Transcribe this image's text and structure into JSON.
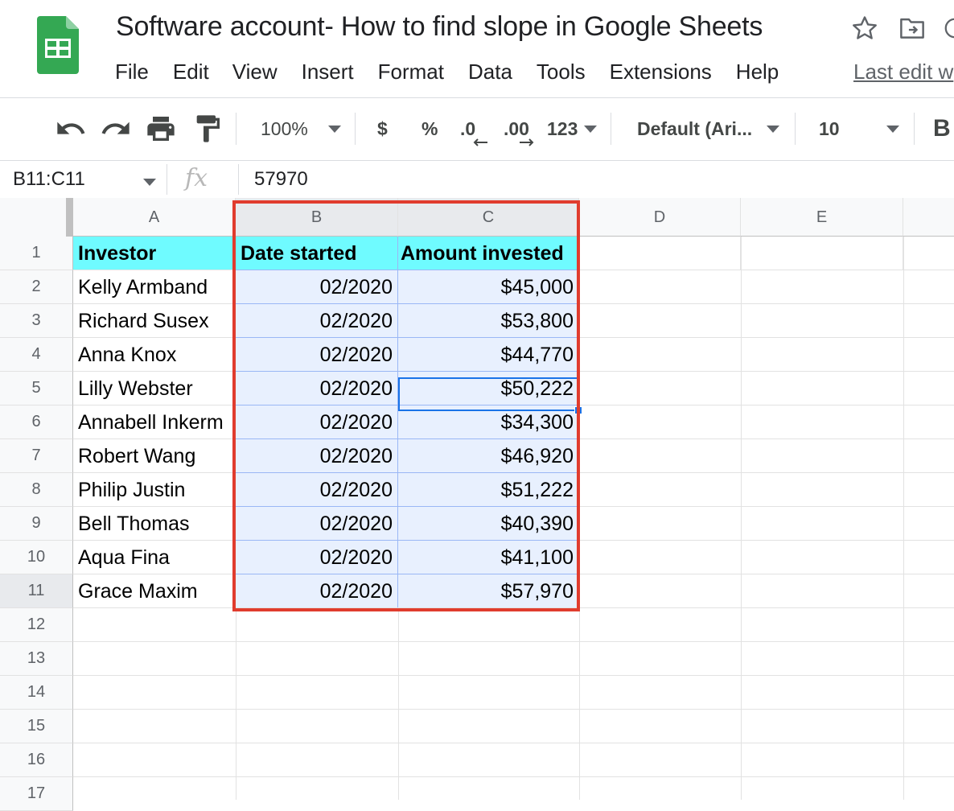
{
  "header": {
    "title": "Software account- How to find slope in Google Sheets",
    "menu": [
      "File",
      "Edit",
      "View",
      "Insert",
      "Format",
      "Data",
      "Tools",
      "Extensions",
      "Help"
    ],
    "last_edit": "Last edit w"
  },
  "toolbar": {
    "zoom": "100%",
    "currency": "$",
    "percent": "%",
    "decrease_decimal": ".0",
    "increase_decimal": ".00",
    "more_formats": "123",
    "font": "Default (Ari...",
    "font_size": "10",
    "bold": "B"
  },
  "formula_bar": {
    "name_box": "B11:C11",
    "fx": "fx",
    "value": "57970"
  },
  "sheet": {
    "columns": [
      "A",
      "B",
      "C",
      "D",
      "E"
    ],
    "rows": [
      "1",
      "2",
      "3",
      "4",
      "5",
      "6",
      "7",
      "8",
      "9",
      "10",
      "11",
      "12",
      "13",
      "14",
      "15",
      "16",
      "17"
    ],
    "header": [
      "Investor",
      "Date started",
      "Amount invested"
    ],
    "data": [
      [
        "Kelly Armband",
        "02/2020",
        "$45,000"
      ],
      [
        "Richard Susex",
        "02/2020",
        "$53,800"
      ],
      [
        "Anna Knox",
        "02/2020",
        "$44,770"
      ],
      [
        "Lilly Webster",
        "02/2020",
        "$50,222"
      ],
      [
        "Annabell Inkerm",
        "02/2020",
        "$34,300"
      ],
      [
        "Robert Wang",
        "02/2020",
        "$46,920"
      ],
      [
        "Philip Justin",
        "02/2020",
        "$51,222"
      ],
      [
        "Bell Thomas",
        "02/2020",
        "$40,390"
      ],
      [
        "Aqua Fina",
        "02/2020",
        "$41,100"
      ],
      [
        "Grace Maxim",
        "02/2020",
        "$57,970"
      ]
    ],
    "header_fill": "#6ffbff",
    "selection_fill": "#e8f0fe",
    "annotation_color": "#e03c2e"
  }
}
